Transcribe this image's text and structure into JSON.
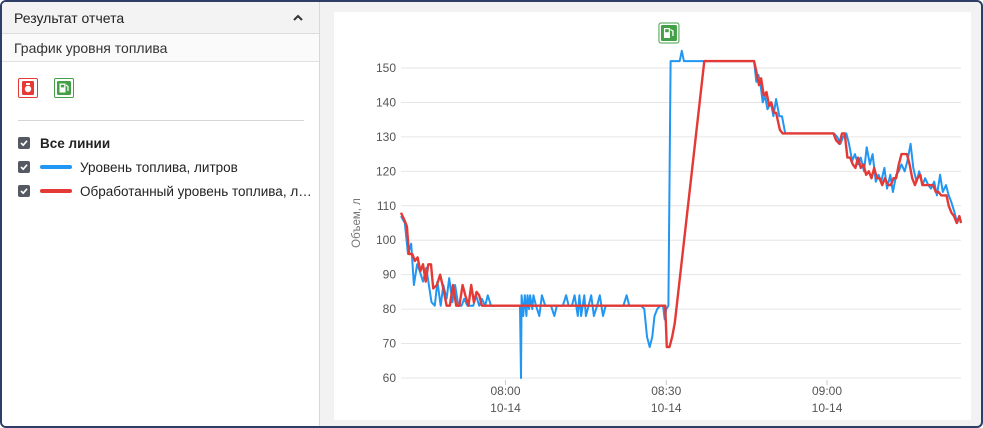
{
  "left_panel": {
    "header_title": "Результат отчета",
    "subheader": "График уровня топлива",
    "event_icons": [
      {
        "name": "fuel-drain-icon",
        "color": "#e53935"
      },
      {
        "name": "fuel-fill-icon",
        "color": "#43a047"
      }
    ],
    "legend": {
      "all_label": "Все линии",
      "items": [
        {
          "label": "Уровень топлива, литров",
          "color": "#2196f3"
        },
        {
          "label": "Обработанный уровень топлива, литров",
          "color": "#e53935"
        }
      ]
    }
  },
  "chart_data": {
    "type": "line",
    "ylabel": "Объем, л",
    "ylim": [
      60,
      155
    ],
    "y_ticks": [
      "60",
      "70",
      "80",
      "90",
      "100",
      "110",
      "120",
      "130",
      "140",
      "150"
    ],
    "x_ticks": [
      {
        "time": "08:00",
        "date": "10-14",
        "t": 0
      },
      {
        "time": "08:30",
        "date": "10-14",
        "t": 30
      },
      {
        "time": "09:00",
        "date": "10-14",
        "t": 60
      }
    ],
    "xlim": [
      -19.5,
      85
    ],
    "grid": "horizontal",
    "fill_marker": {
      "t": 30.5,
      "icon": "fuel-fill-icon",
      "color": "#43a047"
    },
    "series": [
      {
        "name": "Уровень топлива, литров",
        "color": "#2196f3",
        "points": [
          [
            -19.5,
            107
          ],
          [
            -18.8,
            105
          ],
          [
            -18.2,
            96
          ],
          [
            -17.6,
            99
          ],
          [
            -17.1,
            87
          ],
          [
            -16.5,
            93
          ],
          [
            -16.0,
            91
          ],
          [
            -15.4,
            88
          ],
          [
            -14.8,
            92
          ],
          [
            -14.3,
            87
          ],
          [
            -13.8,
            82
          ],
          [
            -13.2,
            81
          ],
          [
            -12.7,
            88
          ],
          [
            -12.1,
            81
          ],
          [
            -11.6,
            87
          ],
          [
            -11.0,
            83
          ],
          [
            -10.5,
            89
          ],
          [
            -9.9,
            82
          ],
          [
            -9.4,
            87
          ],
          [
            -8.8,
            81
          ],
          [
            -8.2,
            81
          ],
          [
            -7.7,
            83
          ],
          [
            -7.1,
            81
          ],
          [
            -6.6,
            81
          ],
          [
            -6.0,
            81
          ],
          [
            -5.5,
            84
          ],
          [
            -4.9,
            81
          ],
          [
            -4.4,
            83
          ],
          [
            -3.8,
            81
          ],
          [
            -3.3,
            84
          ],
          [
            -2.7,
            81
          ],
          [
            -2.2,
            81
          ],
          [
            -1.6,
            81
          ],
          [
            -1.1,
            81
          ],
          [
            -0.5,
            81
          ],
          [
            0.0,
            81
          ],
          [
            0.5,
            81
          ],
          [
            1.1,
            81
          ],
          [
            1.6,
            81
          ],
          [
            2.2,
            81
          ],
          [
            2.7,
            81
          ],
          [
            2.9,
            60
          ],
          [
            3.0,
            84
          ],
          [
            3.3,
            78
          ],
          [
            3.6,
            84
          ],
          [
            3.9,
            78
          ],
          [
            4.1,
            84
          ],
          [
            4.4,
            80
          ],
          [
            4.6,
            84
          ],
          [
            5.0,
            80
          ],
          [
            5.2,
            84
          ],
          [
            5.7,
            81
          ],
          [
            6.3,
            78
          ],
          [
            6.8,
            84
          ],
          [
            7.4,
            81
          ],
          [
            8.0,
            81
          ],
          [
            8.5,
            81
          ],
          [
            9.1,
            78
          ],
          [
            9.6,
            81
          ],
          [
            10.2,
            81
          ],
          [
            10.7,
            81
          ],
          [
            11.3,
            84
          ],
          [
            11.8,
            81
          ],
          [
            12.4,
            81
          ],
          [
            12.9,
            84
          ],
          [
            13.5,
            78
          ],
          [
            13.8,
            84
          ],
          [
            14.1,
            78
          ],
          [
            14.4,
            81
          ],
          [
            14.7,
            84
          ],
          [
            15.0,
            78
          ],
          [
            15.5,
            81
          ],
          [
            16.0,
            84
          ],
          [
            16.5,
            78
          ],
          [
            17.1,
            81
          ],
          [
            17.6,
            84
          ],
          [
            18.2,
            78
          ],
          [
            18.7,
            81
          ],
          [
            19.3,
            81
          ],
          [
            19.8,
            81
          ],
          [
            20.4,
            81
          ],
          [
            20.9,
            81
          ],
          [
            21.4,
            81
          ],
          [
            22.0,
            81
          ],
          [
            22.6,
            84
          ],
          [
            23.1,
            81
          ],
          [
            23.7,
            81
          ],
          [
            24.2,
            81
          ],
          [
            24.8,
            81
          ],
          [
            25.3,
            81
          ],
          [
            25.9,
            80
          ],
          [
            26.4,
            72
          ],
          [
            26.9,
            69
          ],
          [
            27.4,
            72
          ],
          [
            27.8,
            78
          ],
          [
            28.3,
            80
          ],
          [
            28.9,
            81
          ],
          [
            29.4,
            81
          ],
          [
            29.7,
            77
          ],
          [
            30.0,
            80
          ],
          [
            30.4,
            81
          ],
          [
            30.8,
            152
          ],
          [
            31.4,
            152
          ],
          [
            32.0,
            152
          ],
          [
            32.5,
            152
          ],
          [
            32.9,
            155
          ],
          [
            33.3,
            152
          ],
          [
            33.8,
            152
          ],
          [
            34.4,
            152
          ],
          [
            35.0,
            152
          ],
          [
            35.6,
            152
          ],
          [
            36.2,
            152
          ],
          [
            36.8,
            152
          ],
          [
            37.4,
            152
          ],
          [
            38.0,
            152
          ],
          [
            38.6,
            152
          ],
          [
            39.2,
            152
          ],
          [
            39.8,
            152
          ],
          [
            40.4,
            152
          ],
          [
            41.0,
            152
          ],
          [
            41.6,
            152
          ],
          [
            42.2,
            152
          ],
          [
            42.8,
            152
          ],
          [
            43.4,
            152
          ],
          [
            44.0,
            152
          ],
          [
            44.6,
            152
          ],
          [
            45.2,
            152
          ],
          [
            45.8,
            152
          ],
          [
            46.4,
            152
          ],
          [
            46.8,
            146
          ],
          [
            47.2,
            148
          ],
          [
            47.6,
            145
          ],
          [
            48.0,
            140
          ],
          [
            48.4,
            142
          ],
          [
            48.9,
            138
          ],
          [
            49.5,
            140
          ],
          [
            50.0,
            136
          ],
          [
            50.5,
            141
          ],
          [
            51.1,
            136
          ],
          [
            51.6,
            136
          ],
          [
            52.2,
            131
          ],
          [
            60.4,
            131
          ],
          [
            61.3,
            131
          ],
          [
            61.9,
            130
          ],
          [
            62.5,
            128
          ],
          [
            63.0,
            130
          ],
          [
            63.6,
            131
          ],
          [
            64.1,
            128
          ],
          [
            64.7,
            123
          ],
          [
            65.2,
            125
          ],
          [
            65.8,
            122
          ],
          [
            66.3,
            124
          ],
          [
            66.9,
            120
          ],
          [
            67.4,
            127
          ],
          [
            68.0,
            122
          ],
          [
            68.5,
            125
          ],
          [
            69.1,
            117
          ],
          [
            69.6,
            119
          ],
          [
            70.1,
            117
          ],
          [
            70.7,
            121
          ],
          [
            71.2,
            115
          ],
          [
            71.8,
            119
          ],
          [
            72.3,
            114
          ],
          [
            72.9,
            119
          ],
          [
            73.4,
            120
          ],
          [
            73.9,
            122
          ],
          [
            74.5,
            120
          ],
          [
            75.0,
            123
          ],
          [
            75.6,
            128
          ],
          [
            76.1,
            121
          ],
          [
            76.7,
            117
          ],
          [
            77.2,
            120
          ],
          [
            77.8,
            116
          ],
          [
            78.3,
            118
          ],
          [
            78.9,
            116
          ],
          [
            79.4,
            115
          ],
          [
            80.0,
            117
          ],
          [
            80.5,
            113
          ],
          [
            81.1,
            119
          ],
          [
            81.6,
            114
          ],
          [
            82.2,
            116
          ],
          [
            82.7,
            113
          ],
          [
            83.2,
            111
          ],
          [
            83.8,
            108
          ],
          [
            84.3,
            105
          ],
          [
            84.7,
            107
          ],
          [
            85.0,
            105
          ]
        ]
      },
      {
        "name": "Обработанный уровень топлива, литров",
        "color": "#e53935",
        "points": [
          [
            -19.5,
            108
          ],
          [
            -18.9,
            106
          ],
          [
            -18.4,
            104
          ],
          [
            -18.0,
            96
          ],
          [
            -17.4,
            96
          ],
          [
            -16.9,
            94
          ],
          [
            -16.4,
            95
          ],
          [
            -15.9,
            91
          ],
          [
            -15.4,
            93
          ],
          [
            -14.9,
            88
          ],
          [
            -14.4,
            93
          ],
          [
            -13.9,
            93
          ],
          [
            -13.5,
            86
          ],
          [
            -12.8,
            87
          ],
          [
            -12.2,
            90
          ],
          [
            -11.6,
            86
          ],
          [
            -11.0,
            81
          ],
          [
            -10.4,
            81
          ],
          [
            -9.8,
            87
          ],
          [
            -9.2,
            81
          ],
          [
            -8.6,
            81
          ],
          [
            -8.0,
            87
          ],
          [
            -7.5,
            84
          ],
          [
            -6.9,
            81
          ],
          [
            -6.4,
            87
          ],
          [
            -5.9,
            82
          ],
          [
            -5.4,
            85
          ],
          [
            -4.9,
            84
          ],
          [
            -4.4,
            81
          ],
          [
            -3.9,
            81
          ],
          [
            -3.3,
            81
          ],
          [
            -2.7,
            81
          ],
          [
            25.9,
            81
          ],
          [
            26.6,
            81
          ],
          [
            27.3,
            81
          ],
          [
            28.0,
            81
          ],
          [
            28.6,
            81
          ],
          [
            29.2,
            81
          ],
          [
            29.8,
            81
          ],
          [
            30.1,
            69
          ],
          [
            30.6,
            69
          ],
          [
            31.1,
            72
          ],
          [
            31.6,
            76
          ],
          [
            37.1,
            152
          ],
          [
            46.4,
            152
          ],
          [
            46.8,
            149
          ],
          [
            47.3,
            145
          ],
          [
            47.7,
            147
          ],
          [
            48.2,
            142
          ],
          [
            48.7,
            143
          ],
          [
            49.2,
            139
          ],
          [
            49.6,
            140
          ],
          [
            50.1,
            137
          ],
          [
            50.5,
            137
          ],
          [
            51.2,
            132
          ],
          [
            51.7,
            131
          ],
          [
            60.4,
            131
          ],
          [
            61.2,
            131
          ],
          [
            61.7,
            129
          ],
          [
            62.3,
            128
          ],
          [
            62.8,
            131
          ],
          [
            63.3,
            131
          ],
          [
            63.8,
            124
          ],
          [
            64.3,
            124
          ],
          [
            64.8,
            122
          ],
          [
            65.3,
            121
          ],
          [
            65.8,
            124
          ],
          [
            66.3,
            121
          ],
          [
            66.8,
            122
          ],
          [
            67.3,
            119
          ],
          [
            67.8,
            120
          ],
          [
            68.3,
            118
          ],
          [
            68.8,
            121
          ],
          [
            69.3,
            118
          ],
          [
            69.8,
            118
          ],
          [
            70.3,
            116
          ],
          [
            70.8,
            118
          ],
          [
            71.4,
            116
          ],
          [
            71.9,
            116
          ],
          [
            72.4,
            118
          ],
          [
            72.9,
            118
          ],
          [
            73.4,
            122
          ],
          [
            73.9,
            125
          ],
          [
            74.4,
            125
          ],
          [
            74.9,
            125
          ],
          [
            75.4,
            122
          ],
          [
            75.9,
            118
          ],
          [
            76.4,
            116
          ],
          [
            76.9,
            118
          ],
          [
            77.4,
            119
          ],
          [
            77.8,
            116
          ],
          [
            78.3,
            116
          ],
          [
            78.8,
            116
          ],
          [
            79.3,
            116
          ],
          [
            79.8,
            116
          ],
          [
            80.3,
            114
          ],
          [
            80.8,
            114
          ],
          [
            81.3,
            113
          ],
          [
            81.8,
            113
          ],
          [
            82.3,
            113
          ],
          [
            82.7,
            110
          ],
          [
            83.2,
            108
          ],
          [
            83.7,
            107
          ],
          [
            84.2,
            105
          ],
          [
            84.7,
            107
          ],
          [
            85.0,
            105
          ]
        ]
      }
    ]
  }
}
